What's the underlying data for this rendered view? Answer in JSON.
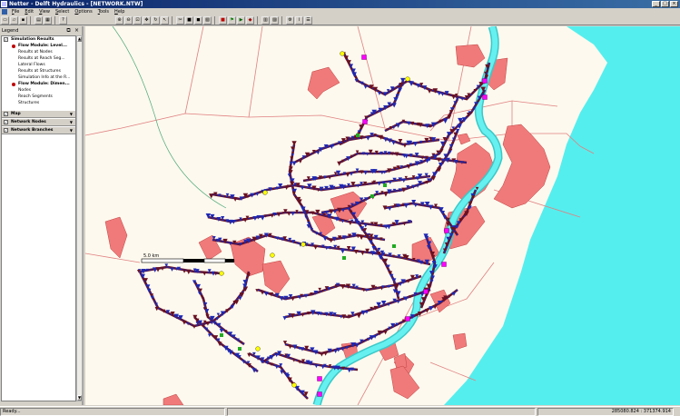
{
  "window": {
    "title": "Netter - Delft Hydraulics - [NETWORK.NTW]"
  },
  "menu": [
    "File",
    "Edit",
    "View",
    "Select",
    "Options",
    "Tools",
    "Help"
  ],
  "legend": {
    "title": "Legend",
    "items": [
      {
        "kind": "group",
        "label": "Simulation Results"
      },
      {
        "kind": "bullet",
        "label": "Flow Module: Level..."
      },
      {
        "kind": "item",
        "label": "Results at Nodes"
      },
      {
        "kind": "item",
        "label": "Results at Reach Seg..."
      },
      {
        "kind": "item",
        "label": "Lateral Flows"
      },
      {
        "kind": "item",
        "label": "Results at Structures"
      },
      {
        "kind": "item",
        "label": "Simulation Info at the R..."
      },
      {
        "kind": "bullet",
        "label": "Flow Module: Dimen..."
      },
      {
        "kind": "item",
        "label": "Nodes"
      },
      {
        "kind": "item",
        "label": "Reach Segments"
      },
      {
        "kind": "item",
        "label": "Structures"
      }
    ],
    "layers": [
      "Map",
      "Network Nodes",
      "Network Branches"
    ]
  },
  "map": {
    "scalebar_label": "5.0 km",
    "colors": {
      "land": "#fdf9ee",
      "sea": "#55eeee",
      "river": "#44e8e8",
      "urban": "#f07a7a",
      "boundary": "#e08080",
      "network_blue": "#1e28b4",
      "network_red": "#6a1020",
      "node_yellow": "#ffff00",
      "node_magenta": "#ff00ff",
      "node_green": "#22aa22"
    }
  },
  "status": {
    "ready": "Ready...",
    "coordinates": "285080.824 : 371374.914"
  }
}
